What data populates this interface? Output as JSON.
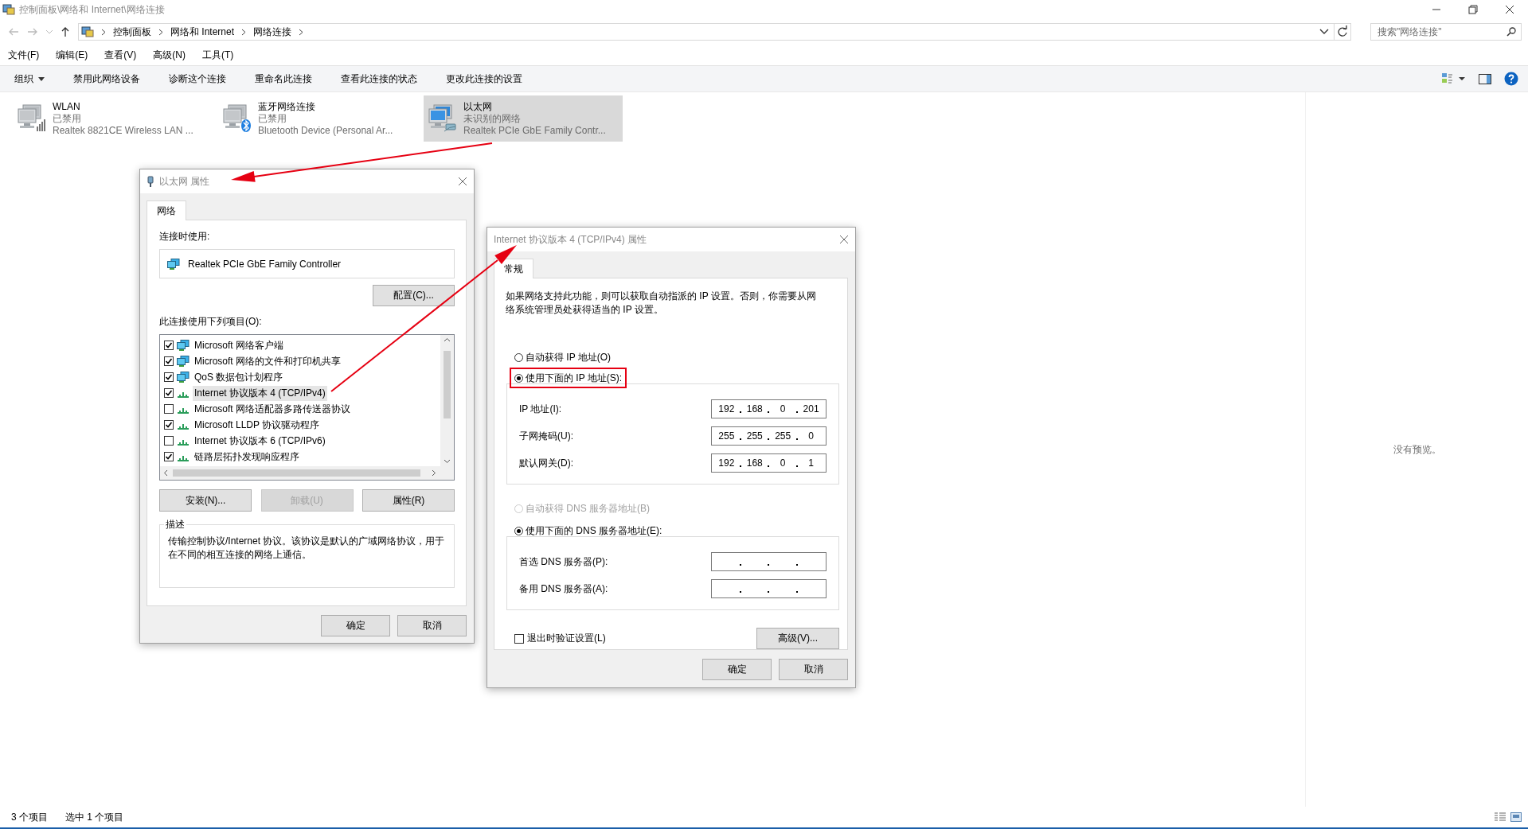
{
  "window": {
    "title": "控制面板\\网络和 Internet\\网络连接"
  },
  "address_bar": {
    "crumbs": [
      "控制面板",
      "网络和 Internet",
      "网络连接"
    ]
  },
  "search": {
    "placeholder": "搜索\"网络连接\""
  },
  "menu": [
    "文件(F)",
    "编辑(E)",
    "查看(V)",
    "高级(N)",
    "工具(T)"
  ],
  "toolbar": [
    {
      "label": "组织",
      "kind": "dropdown"
    },
    {
      "label": "禁用此网络设备",
      "kind": "command"
    },
    {
      "label": "诊断这个连接",
      "kind": "command"
    },
    {
      "label": "重命名此连接",
      "kind": "command"
    },
    {
      "label": "查看此连接的状态",
      "kind": "command"
    },
    {
      "label": "更改此连接的设置",
      "kind": "command"
    }
  ],
  "connections": [
    {
      "name": "WLAN",
      "status": "已禁用",
      "device": "Realtek 8821CE Wireless LAN ...",
      "kind": "wifi",
      "selected": false
    },
    {
      "name": "蓝牙网络连接",
      "status": "已禁用",
      "device": "Bluetooth Device (Personal Ar...",
      "kind": "bluetooth",
      "selected": false
    },
    {
      "name": "以太网",
      "status": "未识别的网络",
      "device": "Realtek PCIe GbE Family Contr...",
      "kind": "ethernet",
      "selected": true
    }
  ],
  "preview": {
    "text": "没有预览。"
  },
  "status_bar": {
    "count": "3 个项目",
    "selection": "选中 1 个项目"
  },
  "ethernet_dialog": {
    "title": "以太网 属性",
    "tabs": [
      {
        "label": "网络",
        "selected": true
      }
    ],
    "connect_label": "连接时使用:",
    "adapter": "Realtek PCIe GbE Family Controller",
    "configure_button": "配置(C)...",
    "items_label": "此连接使用下列项目(O):",
    "items": [
      {
        "label": "Microsoft 网络客户端",
        "checked": true,
        "kind": "client",
        "selected": false
      },
      {
        "label": "Microsoft 网络的文件和打印机共享",
        "checked": true,
        "kind": "client",
        "selected": false
      },
      {
        "label": "QoS 数据包计划程序",
        "checked": true,
        "kind": "client",
        "selected": false
      },
      {
        "label": "Internet 协议版本 4 (TCP/IPv4)",
        "checked": true,
        "kind": "protocol",
        "selected": true
      },
      {
        "label": "Microsoft 网络适配器多路传送器协议",
        "checked": false,
        "kind": "protocol",
        "selected": false
      },
      {
        "label": "Microsoft LLDP 协议驱动程序",
        "checked": true,
        "kind": "protocol",
        "selected": false
      },
      {
        "label": "Internet 协议版本 6 (TCP/IPv6)",
        "checked": false,
        "kind": "protocol",
        "selected": false
      },
      {
        "label": "链路层拓扑发现响应程序",
        "checked": true,
        "kind": "protocol",
        "selected": false
      }
    ],
    "buttons": [
      {
        "label": "安装(N)...",
        "disabled": false
      },
      {
        "label": "卸载(U)",
        "disabled": true
      },
      {
        "label": "属性(R)",
        "disabled": false
      }
    ],
    "description_title": "描述",
    "description": "传输控制协议/Internet 协议。该协议是默认的广域网络协议，用于在不同的相互连接的网络上通信。",
    "ok": "确定",
    "cancel": "取消"
  },
  "ipv4_dialog": {
    "title": "Internet 协议版本 4 (TCP/IPv4) 属性",
    "tabs": [
      {
        "label": "常规",
        "selected": true
      }
    ],
    "intro": "如果网络支持此功能，则可以获取自动指派的 IP 设置。否则，你需要从网络系统管理员处获得适当的 IP 设置。",
    "ip_modes": [
      {
        "label": "自动获得 IP 地址(O)",
        "selected": false,
        "disabled": false
      },
      {
        "label": "使用下面的 IP 地址(S):",
        "selected": true,
        "disabled": false
      }
    ],
    "ip_fields": [
      {
        "label": "IP 地址(I):",
        "octets": [
          "192",
          "168",
          "0",
          "201"
        ]
      },
      {
        "label": "子网掩码(U):",
        "octets": [
          "255",
          "255",
          "255",
          "0"
        ]
      },
      {
        "label": "默认网关(D):",
        "octets": [
          "192",
          "168",
          "0",
          "1"
        ]
      }
    ],
    "dns_modes": [
      {
        "label": "自动获得 DNS 服务器地址(B)",
        "selected": false,
        "disabled": true
      },
      {
        "label": "使用下面的 DNS 服务器地址(E):",
        "selected": true,
        "disabled": false
      }
    ],
    "dns_fields": [
      {
        "label": "首选 DNS 服务器(P):"
      },
      {
        "label": "备用 DNS 服务器(A):"
      }
    ],
    "validate": {
      "label": "退出时验证设置(L)",
      "checked": false
    },
    "advanced_button": "高级(V)...",
    "ok": "确定",
    "cancel": "取消"
  }
}
